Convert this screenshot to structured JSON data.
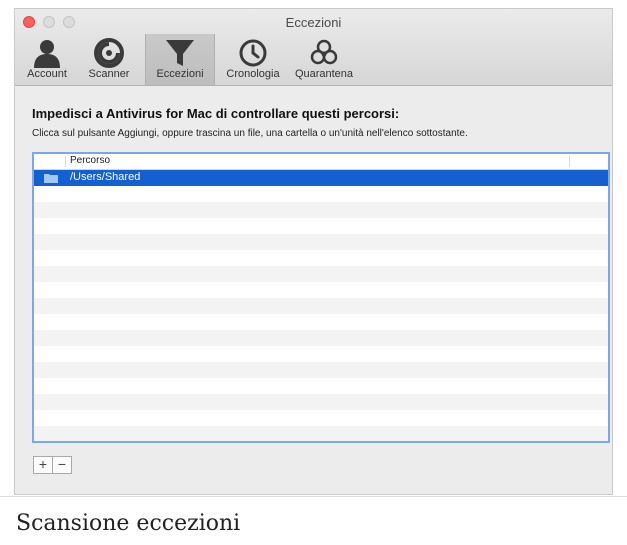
{
  "window": {
    "title": "Eccezioni"
  },
  "toolbar": {
    "items": [
      {
        "label": "Account",
        "icon": "user-icon"
      },
      {
        "label": "Scanner",
        "icon": "scanner-icon"
      },
      {
        "label": "Eccezioni",
        "icon": "funnel-icon",
        "active": true
      },
      {
        "label": "Cronologia",
        "icon": "clock-icon"
      },
      {
        "label": "Quarantena",
        "icon": "biohazard-icon"
      }
    ]
  },
  "main": {
    "heading": "Impedisci a Antivirus for Mac di controllare questi percorsi:",
    "description": "Clicca sul pulsante Aggiungi, oppure trascina un file, una cartella o un'unità nell'elenco sottostante.",
    "table": {
      "column": "Percorso",
      "rows": [
        {
          "path": "/Users/Shared",
          "selected": true
        }
      ]
    },
    "buttons": {
      "add": "+",
      "remove": "−"
    }
  },
  "caption": "Scansione eccezioni",
  "colors": {
    "selection": "#1560d1",
    "focus_ring": "#7aa7e8",
    "close": "#fc605c"
  }
}
